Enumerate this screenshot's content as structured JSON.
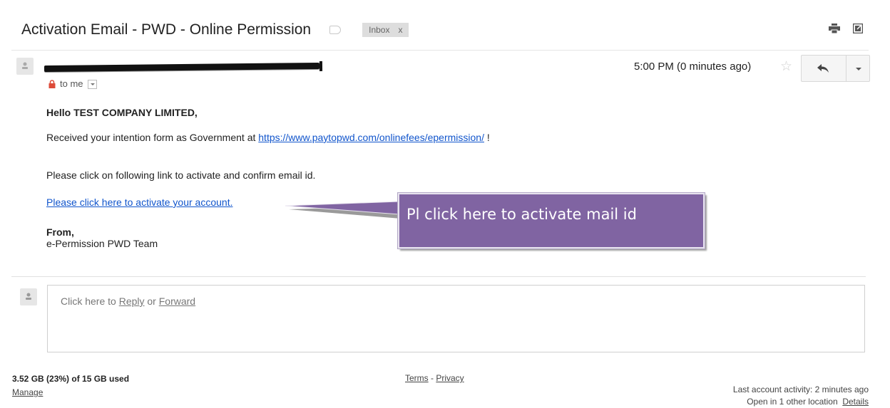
{
  "thread": {
    "subject": "Activation Email - PWD - Online Permission",
    "label": "Inbox",
    "label_remove": "x"
  },
  "message": {
    "recipient": "to me",
    "timestamp": "5:00 PM (0 minutes ago)",
    "greeting": "Hello TEST COMPANY LIMITED,",
    "line1_prefix": "Received your intention form as Government at ",
    "line1_link": "https://www.paytopwd.com/onlinefees/epermission/",
    "line1_suffix": " !",
    "line2": "Please click on following link to activate and confirm email id.",
    "activate_link": "Please click here to activate your account.",
    "from_label": "From,",
    "from_team": "e-Permission PWD Team"
  },
  "annotation": {
    "callout_text": "Pl click here to activate mail id",
    "callout_color": "#8064a2"
  },
  "reply_box": {
    "prefix": "Click here to ",
    "reply": "Reply",
    "middle": " or ",
    "forward": "Forward"
  },
  "footer": {
    "storage": "3.52 GB (23%) of 15 GB used",
    "manage": "Manage",
    "terms": "Terms",
    "separator": " - ",
    "privacy": "Privacy",
    "last_activity": "Last account activity: 2 minutes ago",
    "open_other": "Open in 1 other location",
    "details": "Details"
  },
  "icons": [
    "print-icon",
    "new-window-icon",
    "label-tag-icon",
    "avatar-icon",
    "lock-icon",
    "star-icon",
    "reply-icon",
    "chevron-down-icon"
  ],
  "colors": {
    "link": "#1155cc",
    "callout": "#8064a2",
    "lock": "#dd4b39"
  }
}
